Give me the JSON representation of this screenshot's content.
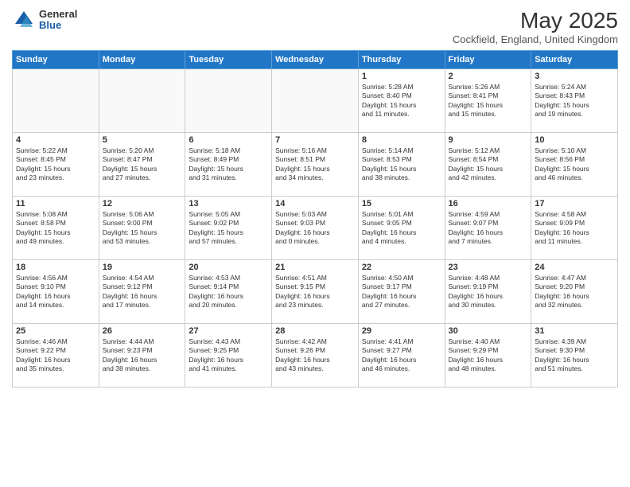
{
  "header": {
    "logo_general": "General",
    "logo_blue": "Blue",
    "title": "May 2025",
    "location": "Cockfield, England, United Kingdom"
  },
  "days_of_week": [
    "Sunday",
    "Monday",
    "Tuesday",
    "Wednesday",
    "Thursday",
    "Friday",
    "Saturday"
  ],
  "weeks": [
    [
      {
        "num": "",
        "info": "",
        "empty": true
      },
      {
        "num": "",
        "info": "",
        "empty": true
      },
      {
        "num": "",
        "info": "",
        "empty": true
      },
      {
        "num": "",
        "info": "",
        "empty": true
      },
      {
        "num": "1",
        "info": "Sunrise: 5:28 AM\nSunset: 8:40 PM\nDaylight: 15 hours\nand 11 minutes."
      },
      {
        "num": "2",
        "info": "Sunrise: 5:26 AM\nSunset: 8:41 PM\nDaylight: 15 hours\nand 15 minutes."
      },
      {
        "num": "3",
        "info": "Sunrise: 5:24 AM\nSunset: 8:43 PM\nDaylight: 15 hours\nand 19 minutes."
      }
    ],
    [
      {
        "num": "4",
        "info": "Sunrise: 5:22 AM\nSunset: 8:45 PM\nDaylight: 15 hours\nand 23 minutes."
      },
      {
        "num": "5",
        "info": "Sunrise: 5:20 AM\nSunset: 8:47 PM\nDaylight: 15 hours\nand 27 minutes."
      },
      {
        "num": "6",
        "info": "Sunrise: 5:18 AM\nSunset: 8:49 PM\nDaylight: 15 hours\nand 31 minutes."
      },
      {
        "num": "7",
        "info": "Sunrise: 5:16 AM\nSunset: 8:51 PM\nDaylight: 15 hours\nand 34 minutes."
      },
      {
        "num": "8",
        "info": "Sunrise: 5:14 AM\nSunset: 8:53 PM\nDaylight: 15 hours\nand 38 minutes."
      },
      {
        "num": "9",
        "info": "Sunrise: 5:12 AM\nSunset: 8:54 PM\nDaylight: 15 hours\nand 42 minutes."
      },
      {
        "num": "10",
        "info": "Sunrise: 5:10 AM\nSunset: 8:56 PM\nDaylight: 15 hours\nand 46 minutes."
      }
    ],
    [
      {
        "num": "11",
        "info": "Sunrise: 5:08 AM\nSunset: 8:58 PM\nDaylight: 15 hours\nand 49 minutes."
      },
      {
        "num": "12",
        "info": "Sunrise: 5:06 AM\nSunset: 9:00 PM\nDaylight: 15 hours\nand 53 minutes."
      },
      {
        "num": "13",
        "info": "Sunrise: 5:05 AM\nSunset: 9:02 PM\nDaylight: 15 hours\nand 57 minutes."
      },
      {
        "num": "14",
        "info": "Sunrise: 5:03 AM\nSunset: 9:03 PM\nDaylight: 16 hours\nand 0 minutes."
      },
      {
        "num": "15",
        "info": "Sunrise: 5:01 AM\nSunset: 9:05 PM\nDaylight: 16 hours\nand 4 minutes."
      },
      {
        "num": "16",
        "info": "Sunrise: 4:59 AM\nSunset: 9:07 PM\nDaylight: 16 hours\nand 7 minutes."
      },
      {
        "num": "17",
        "info": "Sunrise: 4:58 AM\nSunset: 9:09 PM\nDaylight: 16 hours\nand 11 minutes."
      }
    ],
    [
      {
        "num": "18",
        "info": "Sunrise: 4:56 AM\nSunset: 9:10 PM\nDaylight: 16 hours\nand 14 minutes."
      },
      {
        "num": "19",
        "info": "Sunrise: 4:54 AM\nSunset: 9:12 PM\nDaylight: 16 hours\nand 17 minutes."
      },
      {
        "num": "20",
        "info": "Sunrise: 4:53 AM\nSunset: 9:14 PM\nDaylight: 16 hours\nand 20 minutes."
      },
      {
        "num": "21",
        "info": "Sunrise: 4:51 AM\nSunset: 9:15 PM\nDaylight: 16 hours\nand 23 minutes."
      },
      {
        "num": "22",
        "info": "Sunrise: 4:50 AM\nSunset: 9:17 PM\nDaylight: 16 hours\nand 27 minutes."
      },
      {
        "num": "23",
        "info": "Sunrise: 4:48 AM\nSunset: 9:19 PM\nDaylight: 16 hours\nand 30 minutes."
      },
      {
        "num": "24",
        "info": "Sunrise: 4:47 AM\nSunset: 9:20 PM\nDaylight: 16 hours\nand 32 minutes."
      }
    ],
    [
      {
        "num": "25",
        "info": "Sunrise: 4:46 AM\nSunset: 9:22 PM\nDaylight: 16 hours\nand 35 minutes."
      },
      {
        "num": "26",
        "info": "Sunrise: 4:44 AM\nSunset: 9:23 PM\nDaylight: 16 hours\nand 38 minutes."
      },
      {
        "num": "27",
        "info": "Sunrise: 4:43 AM\nSunset: 9:25 PM\nDaylight: 16 hours\nand 41 minutes."
      },
      {
        "num": "28",
        "info": "Sunrise: 4:42 AM\nSunset: 9:26 PM\nDaylight: 16 hours\nand 43 minutes."
      },
      {
        "num": "29",
        "info": "Sunrise: 4:41 AM\nSunset: 9:27 PM\nDaylight: 16 hours\nand 46 minutes."
      },
      {
        "num": "30",
        "info": "Sunrise: 4:40 AM\nSunset: 9:29 PM\nDaylight: 16 hours\nand 48 minutes."
      },
      {
        "num": "31",
        "info": "Sunrise: 4:39 AM\nSunset: 9:30 PM\nDaylight: 16 hours\nand 51 minutes."
      }
    ]
  ]
}
